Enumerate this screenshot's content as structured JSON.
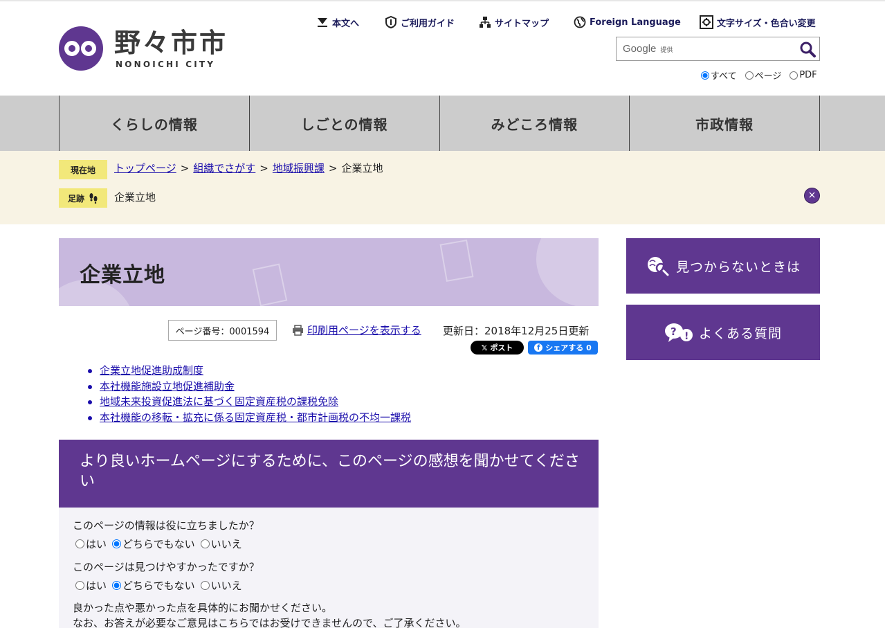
{
  "header": {
    "logo_jp": "野々市市",
    "logo_en": "NONOICHI CITY",
    "utility_links": [
      {
        "label": "本文へ",
        "icon": "arrow-down-icon"
      },
      {
        "label": "ご利用ガイド",
        "icon": "shield-icon"
      },
      {
        "label": "サイトマップ",
        "icon": "sitemap-icon"
      },
      {
        "label": "Foreign Language",
        "icon": "globe-icon"
      },
      {
        "label": "文字サイズ・色合い変更",
        "icon": "gear-icon"
      }
    ],
    "search": {
      "brand": "Google",
      "brand_sub": "提供",
      "value": "",
      "placeholder": ""
    },
    "scope_options": [
      "すべて",
      "ページ",
      "PDF"
    ],
    "scope_selected": "すべて"
  },
  "nav": {
    "items": [
      "くらしの情報",
      "しごとの情報",
      "みどころ情報",
      "市政情報"
    ]
  },
  "breadcrumb": {
    "current_label": "現在地",
    "trail": [
      "トップページ",
      "組織でさがす",
      "地域振興課"
    ],
    "separator": ">",
    "current": "企業立地",
    "footprint_label": "足跡",
    "footprint_item": "企業立地",
    "close_symbol": "×"
  },
  "main": {
    "title": "企業立地",
    "page_number": "ページ番号：0001594",
    "print_label": "印刷用ページを表示する",
    "updated": "更新日：2018年12月25日更新",
    "x_post": "ポスト",
    "fb_share": "シェアする 0",
    "links": [
      "企業立地促進助成制度",
      "本社機能施設立地促進補助金",
      "地域未来投資促進法に基づく固定資産税の課税免除",
      "本社機能の移転・拡充に係る固定資産税・都市計画税の不均一課税"
    ]
  },
  "feedback": {
    "heading": "より良いホームページにするために、このページの感想を聞かせてください",
    "q1": "このページの情報は役に立ちましたか？",
    "q2": "このページは見つけやすかったですか？",
    "options": [
      "はい",
      "どちらでもない",
      "いいえ"
    ],
    "selected": "どちらでもない",
    "note1": "良かった点や悪かった点を具体的にお聞かせください。",
    "note2": "なお、お答えが必要なご意見はこちらではお受けできませんので、ご了承ください。"
  },
  "sidebar": {
    "not_found": "見つからないときは",
    "faq": "よくある質問"
  },
  "colors": {
    "brand_purple": "#5f3790",
    "nav_gray": "#cccccc",
    "crumb_bg": "#f8f3e4",
    "tag_yellow": "#f2e87a",
    "banner_lavender": "#c8b8de"
  }
}
